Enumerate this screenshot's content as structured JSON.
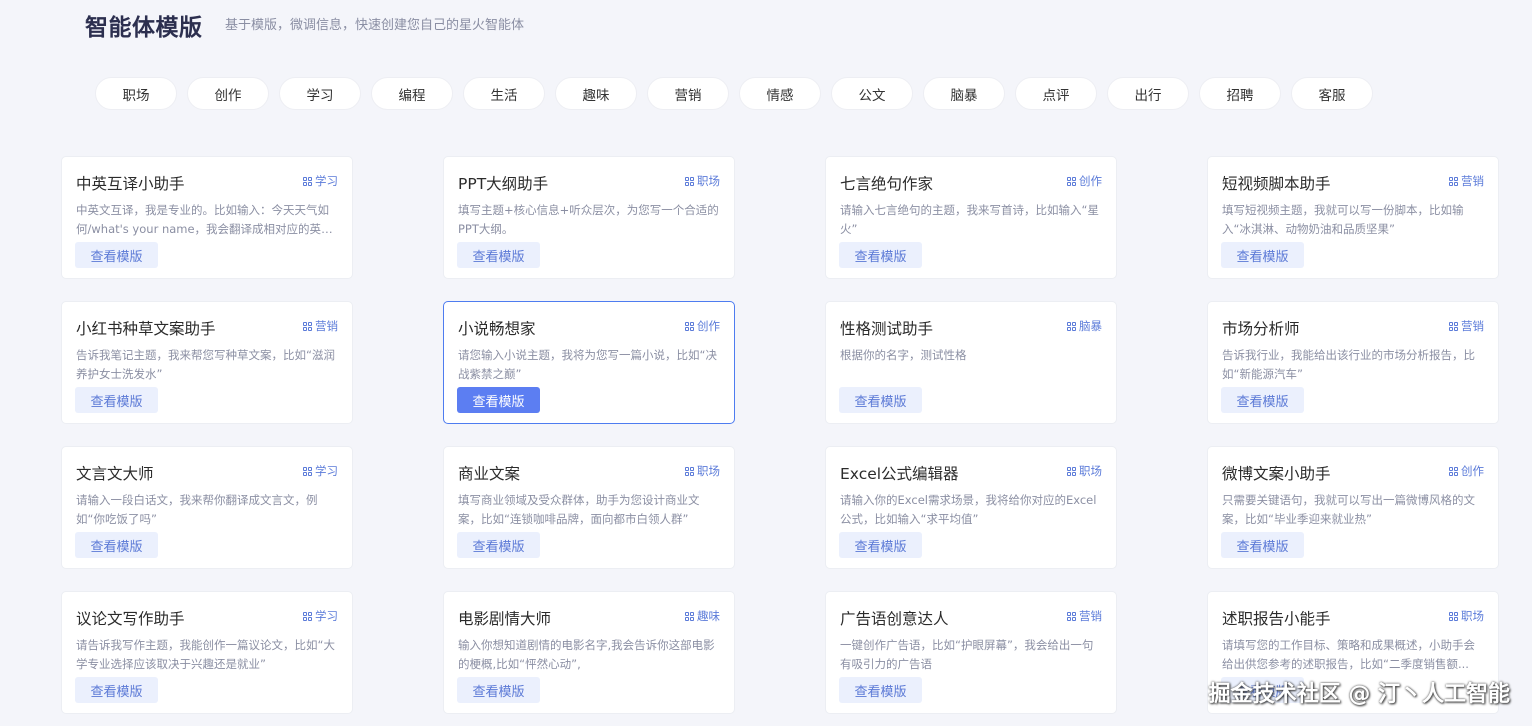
{
  "header": {
    "title": "智能体模版",
    "subtitle": "基于模版，微调信息，快速创建您自己的星火智能体"
  },
  "categories": [
    "职场",
    "创作",
    "学习",
    "编程",
    "生活",
    "趣味",
    "营销",
    "情感",
    "公文",
    "脑暴",
    "点评",
    "出行",
    "招聘",
    "客服"
  ],
  "cards": [
    {
      "title": "中英互译小助手",
      "tag": "学习",
      "desc": "中英文互译，我是专业的。比如输入：今天天气如何/what's your name，我会翻译成相对应的英文...",
      "button": "查看模版"
    },
    {
      "title": "PPT大纲助手",
      "tag": "职场",
      "desc": "填写主题+核心信息+听众层次，为您写一个合适的PPT大纲。",
      "button": "查看模版"
    },
    {
      "title": "七言绝句作家",
      "tag": "创作",
      "desc": "请输入七言绝句的主题，我来写首诗，比如输入“星火”",
      "button": "查看模版"
    },
    {
      "title": "短视频脚本助手",
      "tag": "营销",
      "desc": "填写短视频主题，我就可以写一份脚本，比如输入“冰淇淋、动物奶油和品质坚果”",
      "button": "查看模版"
    },
    {
      "title": "小红书种草文案助手",
      "tag": "营销",
      "desc": "告诉我笔记主题，我来帮您写种草文案，比如“滋润养护女士洗发水”",
      "button": "查看模版"
    },
    {
      "title": "小说畅想家",
      "tag": "创作",
      "desc": "请您输入小说主题，我将为您写一篇小说，比如“决战紫禁之巅”",
      "button": "查看模版"
    },
    {
      "title": "性格测试助手",
      "tag": "脑暴",
      "desc": "根据你的名字，测试性格",
      "button": "查看模版"
    },
    {
      "title": "市场分析师",
      "tag": "营销",
      "desc": "告诉我行业，我能给出该行业的市场分析报告，比如“新能源汽车”",
      "button": "查看模版"
    },
    {
      "title": "文言文大师",
      "tag": "学习",
      "desc": "请输入一段白话文，我来帮你翻译成文言文，例如“你吃饭了吗”",
      "button": "查看模版"
    },
    {
      "title": "商业文案",
      "tag": "职场",
      "desc": "填写商业领域及受众群体，助手为您设计商业文案，比如“连锁咖啡品牌，面向都市白领人群”",
      "button": "查看模版"
    },
    {
      "title": "Excel公式编辑器",
      "tag": "职场",
      "desc": "请输入你的Excel需求场景，我将给你对应的Excel公式，比如输入“求平均值”",
      "button": "查看模版"
    },
    {
      "title": "微博文案小助手",
      "tag": "创作",
      "desc": "只需要关键语句，我就可以写出一篇微博风格的文案，比如“毕业季迎来就业热”",
      "button": "查看模版"
    },
    {
      "title": "议论文写作助手",
      "tag": "学习",
      "desc": "请告诉我写作主题，我能创作一篇议论文，比如“大学专业选择应该取决于兴趣还是就业”",
      "button": "查看模版"
    },
    {
      "title": "电影剧情大师",
      "tag": "趣味",
      "desc": "输入你想知道剧情的电影名字,我会告诉你这部电影的梗概,比如“怦然心动”,",
      "button": "查看模版"
    },
    {
      "title": "广告语创意达人",
      "tag": "营销",
      "desc": "一键创作广告语，比如“护眼屏幕”，我会给出一句有吸引力的广告语",
      "button": "查看模版"
    },
    {
      "title": "述职报告小能手",
      "tag": "职场",
      "desc": "请填写您的工作目标、策略和成果概述，小助手会给出供您参考的述职报告，比如“二季度销售额...",
      "button": "查看模版"
    }
  ],
  "active_card_index": 5,
  "watermark": "掘金技术社区 @ 汀丶人工智能"
}
